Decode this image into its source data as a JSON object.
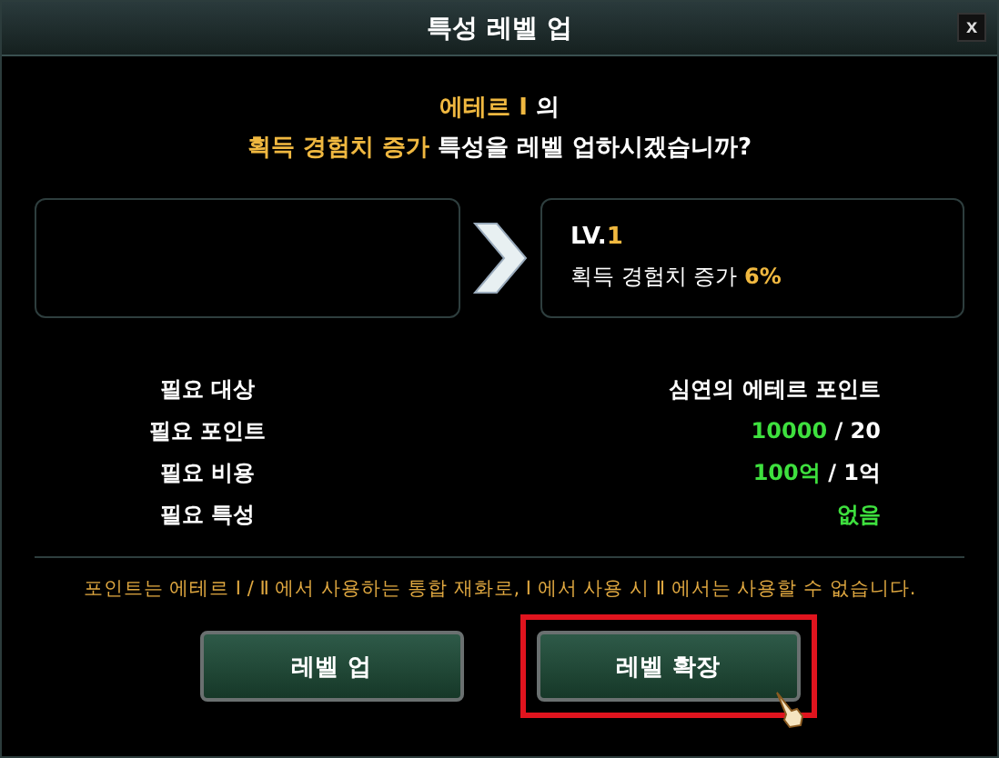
{
  "window": {
    "title": "특성 레벨 업",
    "close": "x"
  },
  "prompt": {
    "subject": "에테르 Ⅰ",
    "subject_suffix": "의",
    "trait": "획득 경험치 증가",
    "question": "특성을 레벨 업하시겠습니까?"
  },
  "next_level": {
    "level_prefix": "LV.",
    "level": "1",
    "effect": "획득 경험치 증가",
    "amount": "6%"
  },
  "requirements": [
    {
      "kind": "plain",
      "label": "필요 대상",
      "value": "심연의 에테르 포인트"
    },
    {
      "kind": "ratio",
      "label": "필요 포인트",
      "have": "10000",
      "need": "/ 20"
    },
    {
      "kind": "ratio",
      "label": "필요 비용",
      "have": "100억",
      "need": "/ 1억"
    },
    {
      "kind": "status",
      "label": "필요 특성",
      "value": "없음"
    }
  ],
  "notice": "포인트는 에테르 Ⅰ / Ⅱ 에서 사용하는 통합 재화로,  Ⅰ 에서 사용 시  Ⅱ 에서는 사용할 수 없습니다.",
  "buttons": [
    {
      "label": "레벨 업",
      "highlighted": false
    },
    {
      "label": "레벨 확장",
      "highlighted": true
    }
  ]
}
